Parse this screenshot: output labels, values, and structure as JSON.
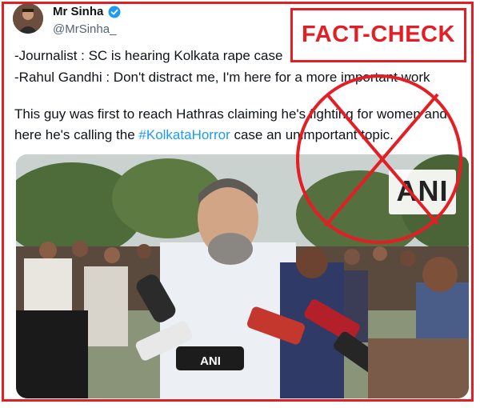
{
  "author": {
    "name": "Mr Sinha",
    "handle": "@MrSinha_",
    "verified": true,
    "avatar_icon": "profile-avatar"
  },
  "menu_icon": "more-options-icon",
  "stamp": {
    "label": "FACT-CHECK",
    "color": "#e31e24"
  },
  "tweet": {
    "line1": "-Journalist : SC is hearing Kolkata rape case",
    "line2": "-Rahul Gandhi : Don't distract me, I'm here for a more important work",
    "line3": "This guy was first to reach Hathras claiming he's fighting for women and",
    "line4_prefix": "here he's calling the ",
    "hashtag": "#KolkataHorror",
    "line4_suffix": " case an unimportant topic."
  },
  "media": {
    "watermark": "ANI",
    "mic_label": "ANI"
  },
  "colors": {
    "accent_red": "#e31e24",
    "link_blue": "#1d9bf0",
    "text": "#0f1419",
    "muted": "#536471"
  }
}
